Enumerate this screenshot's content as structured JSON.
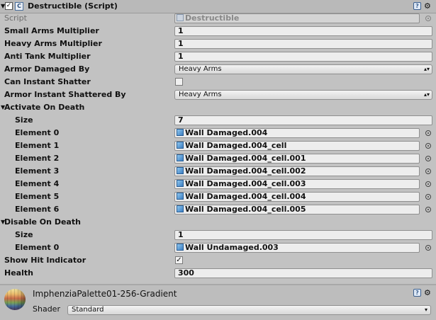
{
  "header": {
    "title": "Destructible (Script)",
    "enabled": true
  },
  "script": {
    "label": "Script",
    "value": "Destructible"
  },
  "fields": {
    "small_arms": {
      "label": "Small Arms Multiplier",
      "value": "1"
    },
    "heavy_arms": {
      "label": "Heavy Arms Multiplier",
      "value": "1"
    },
    "anti_tank": {
      "label": "Anti Tank Multiplier",
      "value": "1"
    },
    "armor_damaged_by": {
      "label": "Armor Damaged By",
      "value": "Heavy Arms"
    },
    "can_instant_shatter": {
      "label": "Can Instant Shatter",
      "checked": false
    },
    "armor_instant_shattered_by": {
      "label": "Armor Instant Shattered By",
      "value": "Heavy Arms"
    }
  },
  "activate_on_death": {
    "label": "Activate On Death",
    "size_label": "Size",
    "size": "7",
    "elements": [
      {
        "label": "Element 0",
        "value": "Wall Damaged.004"
      },
      {
        "label": "Element 1",
        "value": "Wall Damaged.004_cell"
      },
      {
        "label": "Element 2",
        "value": "Wall Damaged.004_cell.001"
      },
      {
        "label": "Element 3",
        "value": "Wall Damaged.004_cell.002"
      },
      {
        "label": "Element 4",
        "value": "Wall Damaged.004_cell.003"
      },
      {
        "label": "Element 5",
        "value": "Wall Damaged.004_cell.004"
      },
      {
        "label": "Element 6",
        "value": "Wall Damaged.004_cell.005"
      }
    ]
  },
  "disable_on_death": {
    "label": "Disable On Death",
    "size_label": "Size",
    "size": "1",
    "elements": [
      {
        "label": "Element 0",
        "value": "Wall Undamaged.003"
      }
    ]
  },
  "show_hit_indicator": {
    "label": "Show Hit Indicator",
    "checked": true
  },
  "health": {
    "label": "Health",
    "value": "300"
  },
  "material": {
    "name": "ImphenziaPalette01-256-Gradient",
    "shader_label": "Shader",
    "shader_value": "Standard"
  },
  "icons": {
    "component": "script-icon",
    "object": "cube-icon",
    "picker": "object-picker-icon",
    "settings": "gear-icon",
    "help": "help-book-icon"
  }
}
